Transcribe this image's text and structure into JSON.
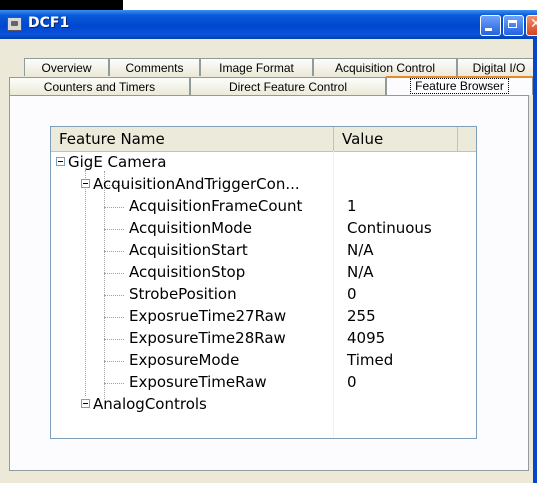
{
  "window": {
    "title": "DCF1"
  },
  "tabs_row1": [
    {
      "label": "Overview"
    },
    {
      "label": "Comments"
    },
    {
      "label": "Image Format"
    },
    {
      "label": "Acquisition Control"
    },
    {
      "label": "Digital I/O"
    }
  ],
  "tabs_row2": [
    {
      "label": "Counters and Timers"
    },
    {
      "label": "Direct Feature Control"
    },
    {
      "label": "Feature Browser",
      "selected": true
    }
  ],
  "tree": {
    "columns": [
      "Feature Name",
      "Value"
    ],
    "rows": [
      {
        "name": "GigE Camera",
        "value": ""
      },
      {
        "name": "AcquisitionAndTriggerCon...",
        "value": ""
      },
      {
        "name": "AcquisitionFrameCount",
        "value": "1"
      },
      {
        "name": "AcquisitionMode",
        "value": "Continuous"
      },
      {
        "name": "AcquisitionStart",
        "value": "N/A"
      },
      {
        "name": "AcquisitionStop",
        "value": "N/A"
      },
      {
        "name": "StrobePosition",
        "value": "0"
      },
      {
        "name": "ExposrueTime27Raw",
        "value": "255"
      },
      {
        "name": "ExposureTime28Raw",
        "value": "4095"
      },
      {
        "name": "ExposureMode",
        "value": "Timed"
      },
      {
        "name": "ExposureTimeRaw",
        "value": "0"
      },
      {
        "name": "AnalogControls",
        "value": ""
      }
    ]
  },
  "colors": {
    "titlebar": "#0047cf",
    "tab_selected_accent": "#e68b2c",
    "client": "#ece9d8"
  },
  "icons": {
    "app": "camera-app-icon",
    "minimize": "minimize-icon",
    "maximize": "maximize-icon",
    "close": "close-icon"
  }
}
